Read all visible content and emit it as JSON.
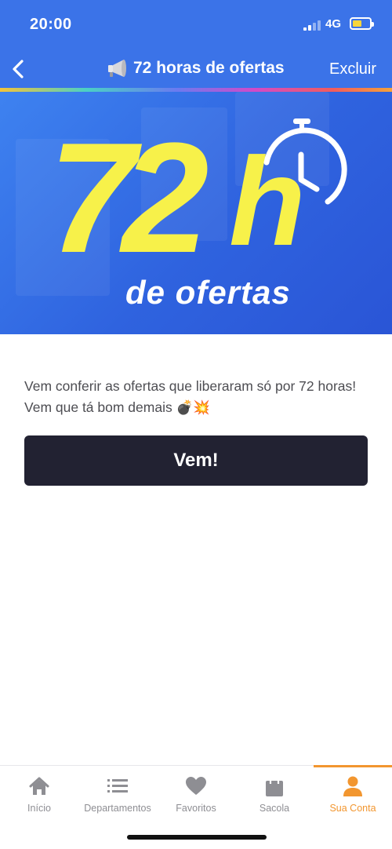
{
  "status_bar": {
    "time": "20:00",
    "network": "4G"
  },
  "nav": {
    "back_icon": "chevron-left-icon",
    "title_icon": "megaphone-icon",
    "title": "72 horas de ofertas",
    "action": "Excluir"
  },
  "banner": {
    "big_number": "72",
    "big_letter": "h",
    "subtitle": "de ofertas",
    "icon": "stopwatch-icon",
    "colors": {
      "background": "#3b73e8",
      "accent": "#f7f14a"
    }
  },
  "content": {
    "description_line1": "Vem conferir as ofertas que liberaram só por 72 horas!",
    "description_line2": "Vem que tá bom demais 💣💥",
    "cta_label": "Vem!"
  },
  "tabbar": {
    "items": [
      {
        "label": "Início",
        "icon": "home-icon",
        "active": false
      },
      {
        "label": "Departamentos",
        "icon": "list-icon",
        "active": false
      },
      {
        "label": "Favoritos",
        "icon": "heart-icon",
        "active": false
      },
      {
        "label": "Sacola",
        "icon": "bag-icon",
        "active": false
      },
      {
        "label": "Sua Conta",
        "icon": "user-icon",
        "active": true
      }
    ],
    "active_color": "#f2962f",
    "inactive_color": "#8e8e93"
  }
}
